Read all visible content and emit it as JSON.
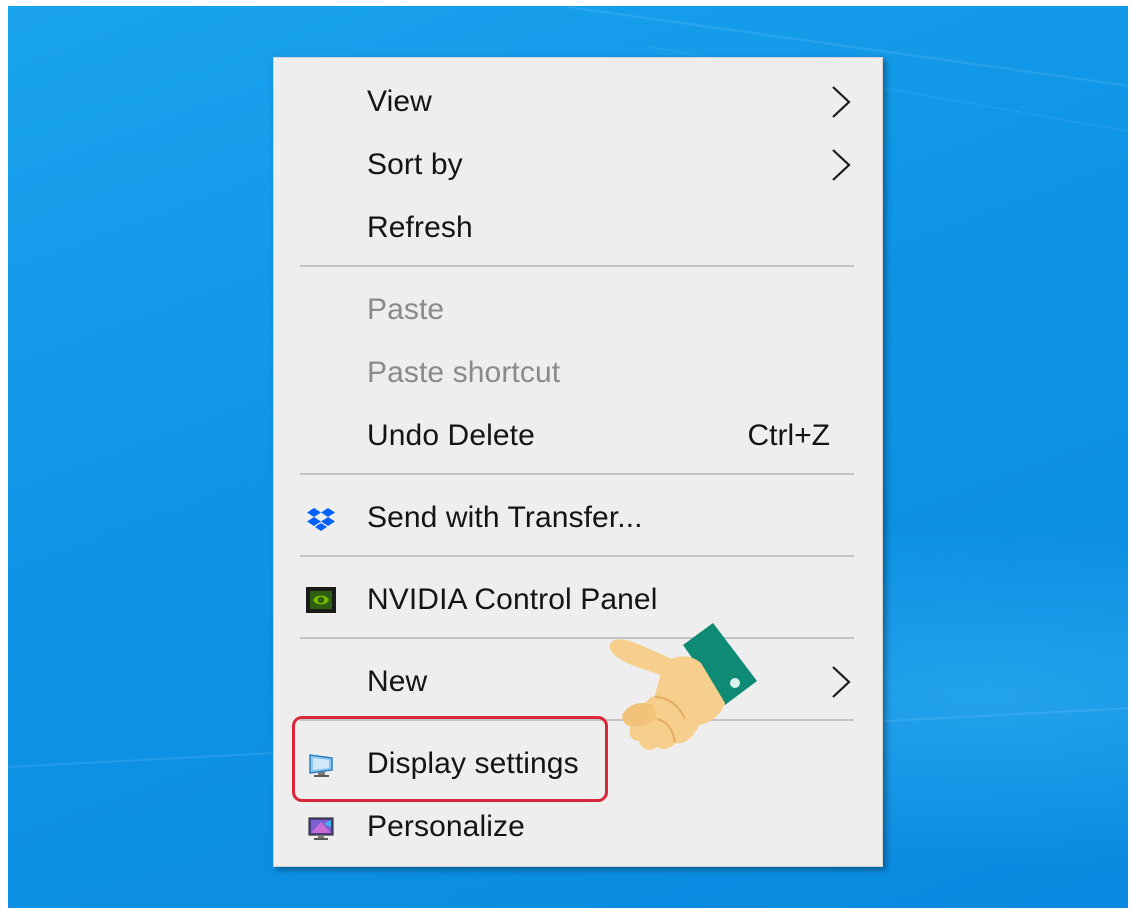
{
  "menu": {
    "items": [
      {
        "label": "View",
        "submenu": true
      },
      {
        "label": "Sort by",
        "submenu": true
      },
      {
        "label": "Refresh"
      },
      {
        "label": "Paste",
        "disabled": true
      },
      {
        "label": "Paste shortcut",
        "disabled": true
      },
      {
        "label": "Undo Delete",
        "shortcut": "Ctrl+Z"
      },
      {
        "label": "Send with Transfer...",
        "icon": "dropbox-icon"
      },
      {
        "label": "NVIDIA Control Panel",
        "icon": "nvidia-icon"
      },
      {
        "label": "New",
        "submenu": true
      },
      {
        "label": "Display settings",
        "icon": "display-icon",
        "highlighted": true
      },
      {
        "label": "Personalize",
        "icon": "personalize-icon"
      }
    ]
  },
  "colors": {
    "desktop_blue": "#0e94e6",
    "menu_background": "#eeeeee",
    "disabled_text": "#8a8a8a",
    "highlight_border": "#d8283a",
    "dropbox_blue": "#0061fe",
    "nvidia_green": "#76b900"
  },
  "annotations": {
    "pointer": "pointing-hand-icon"
  }
}
